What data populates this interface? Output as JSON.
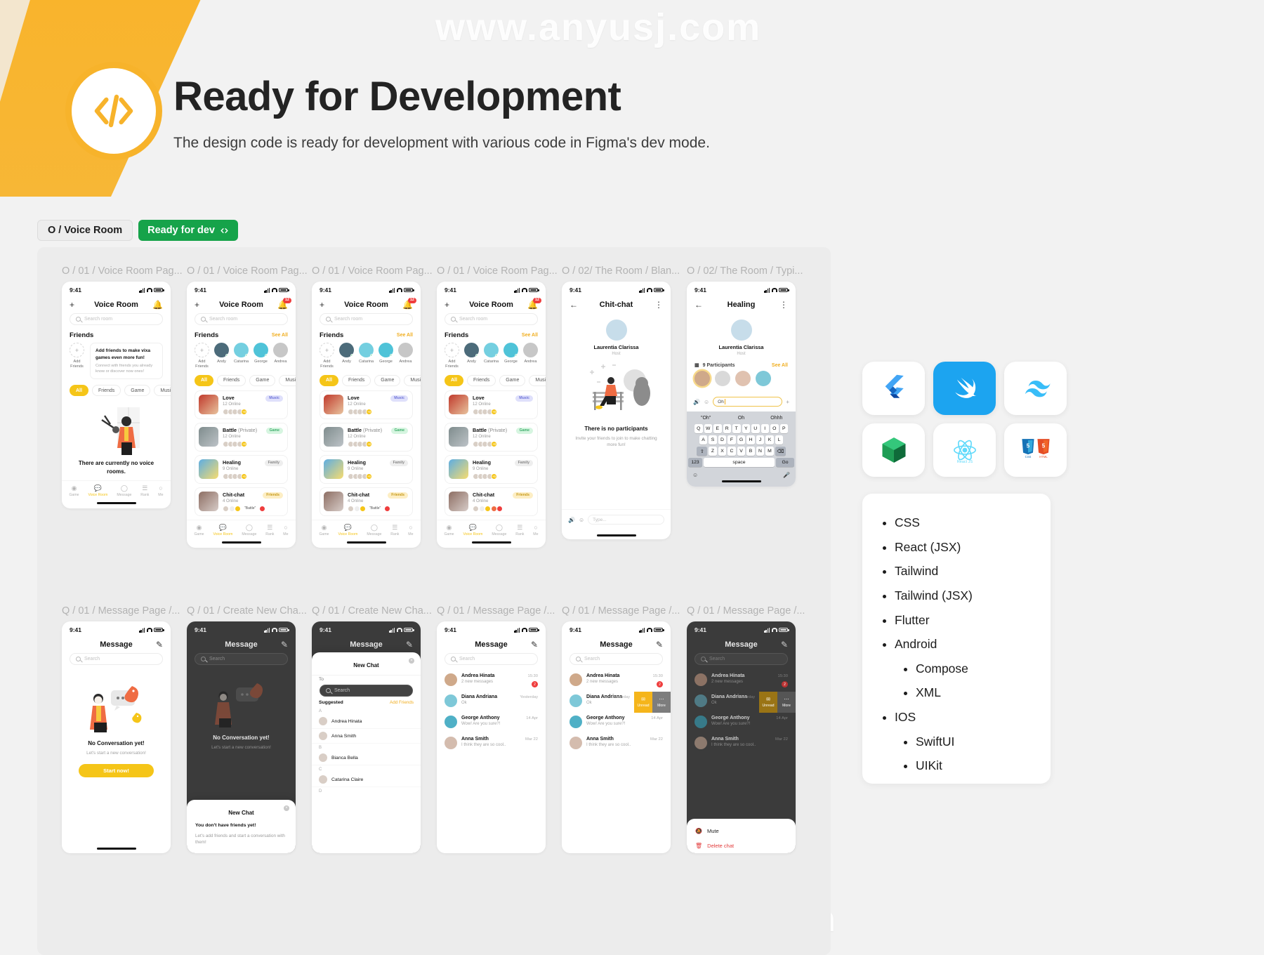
{
  "watermark": {
    "l1": "www.anyusj.com",
    "l2": "www.anyusj.com",
    "l3": "www.anyusj.com"
  },
  "header": {
    "title": "Ready for Development",
    "subtitle": "The design code is ready for development with various code in Figma's dev mode.",
    "logo_icon": "code-brackets-icon",
    "accent": "#f7b32b"
  },
  "tags": {
    "page_tag": "O / Voice Room",
    "ready_tag": "Ready for dev",
    "ready_icon": "code-icon",
    "green": "#16a34a"
  },
  "frames": [
    {
      "label": "O / 01 / Voice Room Pag..."
    },
    {
      "label": "O / 01 / Voice Room Pag..."
    },
    {
      "label": "O / 01 / Voice Room Pag..."
    },
    {
      "label": "O / 01 / Voice Room Pag..."
    },
    {
      "label": "O / 02/ The Room / Blan..."
    },
    {
      "label": "O / 02/ The Room / Typi..."
    },
    {
      "label": "Q / 01 / Message Page /..."
    },
    {
      "label": "Q / 01 / Create New Cha..."
    },
    {
      "label": "Q / 01 / Create New Cha..."
    },
    {
      "label": "Q / 01 / Message Page /..."
    },
    {
      "label": "Q / 01 / Message Page /..."
    },
    {
      "label": "Q / 01 / Message Page /..."
    }
  ],
  "status": {
    "time": "9:41"
  },
  "voice_room": {
    "title": "Voice Room",
    "add_icon": "plus-icon",
    "bell_icon": "bell-icon",
    "badge": "12",
    "search_placeholder": "Search room",
    "friends_label": "Friends",
    "see_all": "See All",
    "add_friends": "Add Friends",
    "friends": [
      "Andy",
      "Catarina",
      "George",
      "Andrea"
    ],
    "promo_title": "Add friends to make vixa games even more fun!",
    "promo_sub": "Connect with friends you already know or discover now ones!",
    "chips": [
      "All",
      "Friends",
      "Game",
      "Music"
    ],
    "empty_title": "There are currently no voice rooms.",
    "rooms": [
      {
        "name": "Love",
        "private": "",
        "online": "12 Online",
        "tag": "Music",
        "tag_class": "t-music",
        "more": "+8"
      },
      {
        "name": "Battle",
        "private": "(Private)",
        "online": "12 Online",
        "tag": "Game",
        "tag_class": "t-game",
        "more": "+8"
      },
      {
        "name": "Healing",
        "private": "",
        "online": "9 Online",
        "tag": "Family",
        "tag_class": "t-family",
        "more": "+5"
      },
      {
        "name": "Chit-chat",
        "private": "",
        "online": "4 Online",
        "tag": "Friends",
        "tag_class": "t-friends",
        "more": "+2"
      }
    ],
    "chitchat_mini": "\"Battle\"",
    "tabs": [
      {
        "label": "Game",
        "icon": "robot-icon"
      },
      {
        "label": "Voice Room",
        "icon": "chat-bubbles-icon"
      },
      {
        "label": "Message",
        "icon": "message-icon"
      },
      {
        "label": "Rank",
        "icon": "podium-icon"
      },
      {
        "label": "Me",
        "icon": "person-icon"
      }
    ]
  },
  "room_blank": {
    "title": "Chit-chat",
    "back_icon": "arrow-left-icon",
    "menu_icon": "kebab-menu-icon",
    "host_name": "Laurentia Clarissa",
    "host_role": "Host",
    "empty_title": "There is no participants",
    "empty_sub": "Invite your friends to join to make chatting more fun!",
    "input_placeholder": "Type...",
    "speaker_icon": "speaker-icon",
    "emoji_icon": "emoji-icon"
  },
  "room_typing": {
    "title": "Healing",
    "back_icon": "arrow-left-icon",
    "menu_icon": "kebab-menu-icon",
    "host_name": "Laurentia Clarissa",
    "host_role": "Host",
    "participants_label": "9 Participants",
    "participants_icon": "people-grid-icon",
    "see_all": "See All",
    "typed_text": "Oh",
    "add_icon": "plus-icon",
    "predictions": [
      "\"Oh\"",
      "Oh",
      "Ohhh"
    ],
    "keyboard": {
      "row1": [
        "Q",
        "W",
        "E",
        "R",
        "T",
        "Y",
        "U",
        "I",
        "O",
        "P"
      ],
      "row2": [
        "A",
        "S",
        "D",
        "F",
        "G",
        "H",
        "J",
        "K",
        "L"
      ],
      "row3": [
        "Z",
        "X",
        "C",
        "V",
        "B",
        "N",
        "M"
      ],
      "shift": "shift-icon",
      "backspace": "backspace-icon",
      "num_key": "123",
      "space": "space",
      "go": "Go",
      "emoji": "emoji-icon",
      "mic": "mic-icon"
    }
  },
  "message_page": {
    "title": "Message",
    "compose_icon": "compose-icon",
    "search_placeholder": "Search",
    "empty_title": "No Conversation yet!",
    "empty_sub": "Let's start a new conversation!",
    "start_button": "Start now!",
    "conversations": [
      {
        "name": "Andrea Hinata",
        "preview": "2 new messages",
        "time": "15:30",
        "count": "2"
      },
      {
        "name": "Diana Andriana",
        "preview": "Ok",
        "time": "Yesterday",
        "count": ""
      },
      {
        "name": "George Anthony",
        "preview": "Wow! Are you sure?!",
        "time": "14 Apr",
        "count": ""
      },
      {
        "name": "Anna Smith",
        "preview": "I think they are so cool..",
        "time": "Mar 22",
        "count": ""
      }
    ],
    "swipe": {
      "unread": "Unread",
      "more": "More",
      "unread_icon": "envelope-icon",
      "more_icon": "ellipsis-icon"
    },
    "context_menu": [
      {
        "label": "Mute",
        "icon": "bell-off-icon"
      },
      {
        "label": "Delete chat",
        "icon": "trash-icon"
      }
    ]
  },
  "new_chat": {
    "title": "New Chat",
    "close_icon": "close-icon",
    "to_label": "To",
    "search_placeholder": "Search",
    "suggested": "Suggested",
    "add_friends": "Add Friends",
    "letters": [
      "A",
      "B",
      "C",
      "D"
    ],
    "contacts_a": [
      "Andrea Hinata",
      "Anna Smith"
    ],
    "contacts_b": [
      "Bianca Bella"
    ],
    "contacts_c": [
      "Catarina Claire"
    ],
    "no_friends_title": "New Chat",
    "no_friends_body": "You don't have friends yet!",
    "no_friends_sub": "Let's add friends and start a conversation with them!",
    "empty_overlay_title": "No Conversation yet!",
    "empty_overlay_sub": "Let's start a new conversation!"
  },
  "tech_cards": [
    {
      "name": "flutter-logo"
    },
    {
      "name": "swift-logo"
    },
    {
      "name": "tailwind-logo"
    },
    {
      "name": "android-compose-logo"
    },
    {
      "name": "react-logo",
      "caption": "React JS"
    },
    {
      "name": "css-html-logo",
      "caption_a": "CSS",
      "caption_b": "HTML"
    }
  ],
  "tech_list": [
    {
      "label": "CSS",
      "children": []
    },
    {
      "label": "React (JSX)",
      "children": []
    },
    {
      "label": "Tailwind",
      "children": []
    },
    {
      "label": "Tailwind (JSX)",
      "children": []
    },
    {
      "label": "Flutter",
      "children": []
    },
    {
      "label": "Android",
      "children": [
        "Compose",
        "XML"
      ]
    },
    {
      "label": "IOS",
      "children": [
        "SwiftUI",
        "UIKit"
      ]
    }
  ]
}
